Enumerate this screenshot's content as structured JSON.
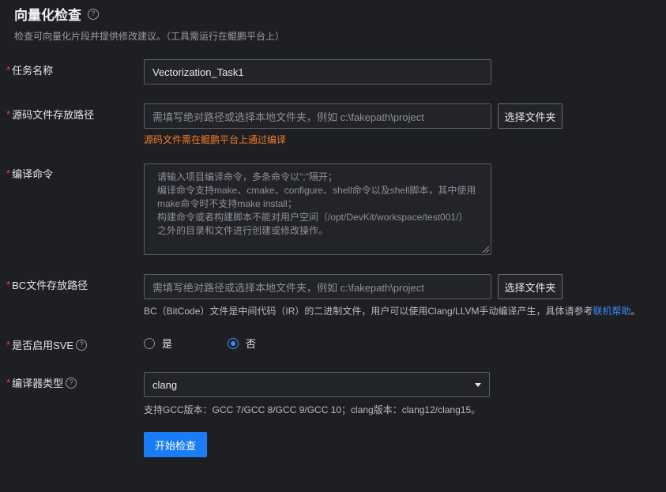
{
  "header": {
    "title": "向量化检查",
    "help_icon": "?",
    "subtitle": "检查可向量化片段并提供修改建议。（工具需运行在鲲鹏平台上）"
  },
  "required_mark": "*",
  "fields": {
    "task_name": {
      "label": "任务名称",
      "value": "Vectorization_Task1"
    },
    "source_path": {
      "label": "源码文件存放路径",
      "placeholder": "需填写绝对路径或选择本地文件夹，例如 c:\\fakepath\\project",
      "button": "选择文件夹",
      "warning": "源码文件需在鲲鹏平台上通过编译"
    },
    "compile_cmd": {
      "label": "编译命令",
      "placeholder_lines": [
        "请输入项目编译命令，多条命令以\";\"隔开；",
        "编译命令支持make、cmake、configure、shell命令以及shell脚本，其中使用",
        "make命令时不支持make install；",
        "构建命令或者构建脚本不能对用户空间（/opt/DevKit/workspace/test001/）",
        "之外的目录和文件进行创建或修改操作。"
      ]
    },
    "bc_path": {
      "label": "BC文件存放路径",
      "placeholder": "需填写绝对路径或选择本地文件夹，例如 c:\\fakepath\\project",
      "button": "选择文件夹",
      "note_prefix": "BC（BitCode）文件是中间代码（IR）的二进制文件，用户可以使用Clang/LLVM手动编译产生，具体请参考",
      "note_link": "联机帮助",
      "note_suffix": "。"
    },
    "sve": {
      "label": "是否启用SVE",
      "help_icon": "?",
      "options": [
        "是",
        "否"
      ],
      "selected": "否"
    },
    "compiler": {
      "label": "编译器类型",
      "help_icon": "?",
      "value": "clang",
      "note": "支持GCC版本：GCC 7/GCC 8/GCC 9/GCC 10；clang版本：clang12/clang15。"
    }
  },
  "actions": {
    "start_button": "开始检查"
  },
  "colors": {
    "background": "#1e1f23",
    "primary": "#1a7df5",
    "required": "#e5483b",
    "warning": "#f07c2a",
    "link": "#3a8cf7"
  }
}
